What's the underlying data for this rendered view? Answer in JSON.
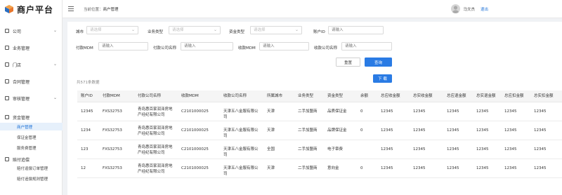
{
  "app": {
    "title": "商户平台"
  },
  "sidebar": {
    "items": [
      {
        "label": "公司",
        "chevron": "⌄"
      },
      {
        "label": "业务管理",
        "chevron": ""
      },
      {
        "label": "门店",
        "chevron": "⌄"
      },
      {
        "label": "合同管理",
        "chevron": ""
      },
      {
        "label": "审核管理",
        "chevron": "⌄"
      },
      {
        "label": "资金管理",
        "chevron": "⌃"
      }
    ],
    "subitems": [
      "商户管理",
      "保证金管理",
      "服务费管理"
    ],
    "section2": {
      "label": "赔付追偿",
      "subitems": [
        "赔付追偿订单管理",
        "赔付追偿规则管理"
      ]
    }
  },
  "header": {
    "breadcrumb_prefix": "当前位置：",
    "breadcrumb_current": "商户管理",
    "user_name": "马文杰",
    "logout": "退出"
  },
  "filters": {
    "city": {
      "label": "城市",
      "placeholder": "请选择"
    },
    "business_type": {
      "label": "业务类型",
      "placeholder": "请选择"
    },
    "fund_type": {
      "label": "资金类型",
      "placeholder": "请选择"
    },
    "account_id": {
      "label": "账户ID",
      "placeholder": "请输入"
    },
    "pay_mdm": {
      "label": "付款MDM",
      "placeholder": "请输入"
    },
    "pay_company": {
      "label": "付款公司名称",
      "placeholder": "请输入"
    },
    "recv_mdm": {
      "label": "收款MDM",
      "placeholder": "请输入"
    },
    "recv_company": {
      "label": "收款公司名称",
      "placeholder": "请输入"
    }
  },
  "buttons": {
    "reset": "重置",
    "query": "查询",
    "download": "下 载"
  },
  "total_text": "共571条数据",
  "table": {
    "columns": [
      "账户ID",
      "付款MDM",
      "付款公司名称",
      "收款MDM",
      "收款公司名称",
      "所属城市",
      "业务类型",
      "资金类型",
      "余额",
      "总应收金额",
      "总实收金额",
      "总应退金额",
      "总实退金额",
      "总应扣金额",
      "总实扣金额"
    ],
    "rows": [
      [
        "12345",
        "FXS32753",
        "青岛惠百家润泽房地产经纪有限公司",
        "C2101000025",
        "天津五八金服有限公司",
        "天津",
        "二手加盟商",
        "品质保证金",
        "0",
        "12345",
        "12345",
        "12345",
        "12345",
        "12345",
        "12345"
      ],
      [
        "1234",
        "FXS32753",
        "青岛惠百家润泽房地产经纪有限公司",
        "C2101000025",
        "天津五八金服有限公司",
        "天津",
        "二手加盟商",
        "品牌保证金",
        "0",
        "12345",
        "12345",
        "12345",
        "12345",
        "12345",
        "12345"
      ],
      [
        "123",
        "FXS32753",
        "青岛惠百家润泽房地产经纪有限公司",
        "C2101000025",
        "天津五八金服有限公司",
        "全国",
        "二手加盟商",
        "电子章费",
        "",
        "12345",
        "12345",
        "12345",
        "12345",
        "12345",
        "12345"
      ],
      [
        "12",
        "FXS32753",
        "青岛惠百家润泽房地产经纪有限公司",
        "C2101000025",
        "天津五八金服有限公司",
        "天津",
        "二手加盟商",
        "意向金",
        "0",
        "12345",
        "12345",
        "12345",
        "12345",
        "12345",
        "12345"
      ]
    ]
  },
  "colors": {
    "accent": "#2a7be4",
    "active_bg": "#e6f0fb",
    "logo_orange": "#e8772e",
    "logo_blue": "#2a6fc2"
  }
}
